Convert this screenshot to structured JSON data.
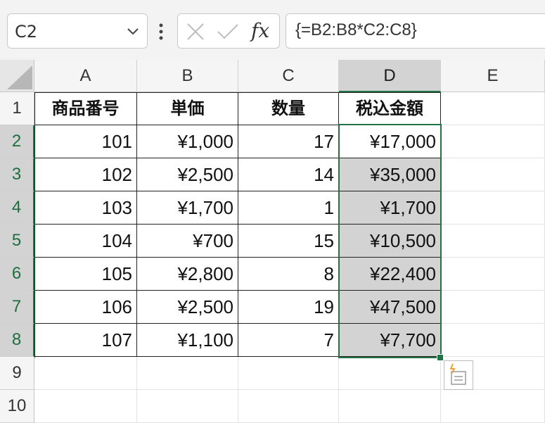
{
  "formula_bar": {
    "name_box": "C2",
    "formula": "{=B2:B8*C2:C8}",
    "fx_label": "fx"
  },
  "columns": [
    "A",
    "B",
    "C",
    "D",
    "E"
  ],
  "rows": [
    "1",
    "2",
    "3",
    "4",
    "5",
    "6",
    "7",
    "8",
    "9",
    "10"
  ],
  "table": {
    "headers": [
      "商品番号",
      "単価",
      "数量",
      "税込金額"
    ],
    "rows": [
      [
        "101",
        "¥1,000",
        "17",
        "¥17,000"
      ],
      [
        "102",
        "¥2,500",
        "14",
        "¥35,000"
      ],
      [
        "103",
        "¥1,700",
        "1",
        "¥1,700"
      ],
      [
        "104",
        "¥700",
        "15",
        "¥10,500"
      ],
      [
        "105",
        "¥2,800",
        "8",
        "¥22,400"
      ],
      [
        "106",
        "¥2,500",
        "19",
        "¥47,500"
      ],
      [
        "107",
        "¥1,100",
        "7",
        "¥7,700"
      ]
    ]
  },
  "colors": {
    "selection": "#217346",
    "selected_fill": "#d3d3d3"
  }
}
